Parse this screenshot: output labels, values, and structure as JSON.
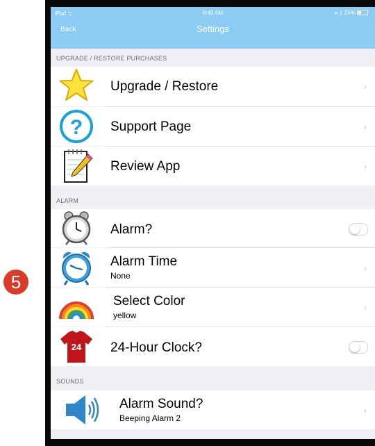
{
  "step_badge": "5",
  "status_bar": {
    "device": "iPad",
    "time": "8:49 AM",
    "battery": "26%"
  },
  "nav": {
    "back_label": "Back",
    "title": "Settings"
  },
  "sections": {
    "upgrade": {
      "header": "UPGRADE / RESTORE PURCHASES",
      "items": [
        {
          "title": "Upgrade / Restore",
          "icon": "star-icon"
        },
        {
          "title": "Support Page",
          "icon": "question-icon"
        },
        {
          "title": "Review App",
          "icon": "notepad-pencil-icon"
        }
      ]
    },
    "alarm": {
      "header": "ALARM",
      "items": [
        {
          "title": "Alarm?",
          "icon": "alarm-clock-icon",
          "toggle": false
        },
        {
          "title": "Alarm Time",
          "subtitle": "None",
          "icon": "blue-clock-icon"
        },
        {
          "title": "Select Color",
          "subtitle": "yellow",
          "icon": "rainbow-icon"
        },
        {
          "title": "24-Hour Clock?",
          "icon": "shirt-24-icon",
          "icon_text": "24",
          "toggle": false
        }
      ]
    },
    "sounds": {
      "header": "SOUNDS",
      "items": [
        {
          "title": "Alarm Sound?",
          "subtitle": "Beeping Alarm 2",
          "icon": "speaker-icon"
        }
      ]
    }
  },
  "chevron": "›",
  "colors": {
    "nav": "#8ccbf3",
    "badge": "#dd3b2a",
    "background": "#efeff4"
  }
}
